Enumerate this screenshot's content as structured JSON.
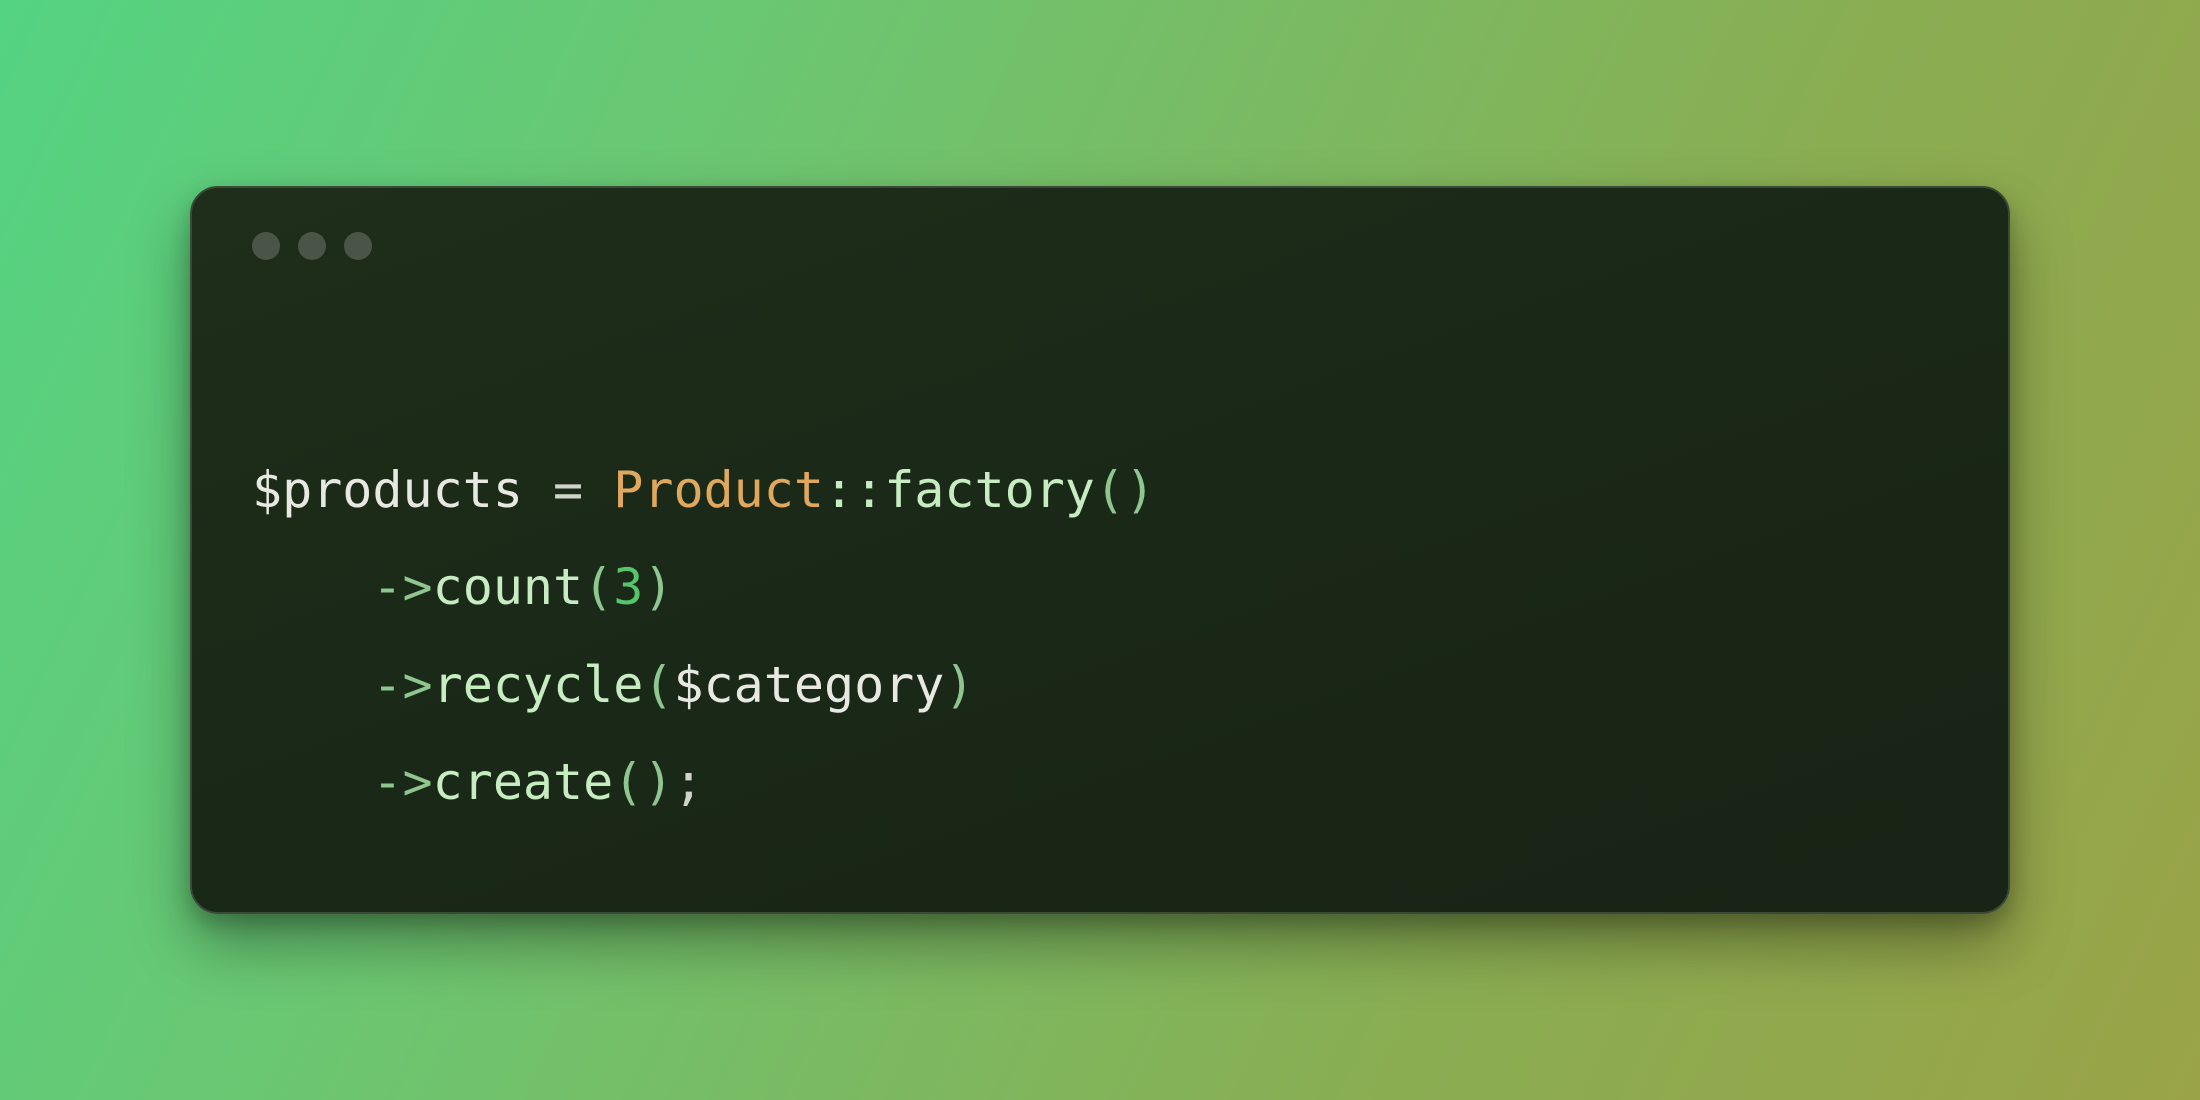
{
  "code": {
    "line1": {
      "var": "$products",
      "assign": " = ",
      "class": "Product",
      "scope": "::",
      "method": "factory",
      "paren_open": "(",
      "paren_close": ")"
    },
    "line2": {
      "arrow": "->",
      "method": "count",
      "paren_open": "(",
      "arg": "3",
      "paren_close": ")"
    },
    "line3": {
      "arrow": "->",
      "method": "recycle",
      "paren_open": "(",
      "arg": "$category",
      "paren_close": ")"
    },
    "line4": {
      "arrow": "->",
      "method": "create",
      "paren_open": "(",
      "paren_close": ")",
      "semi": ";"
    }
  }
}
